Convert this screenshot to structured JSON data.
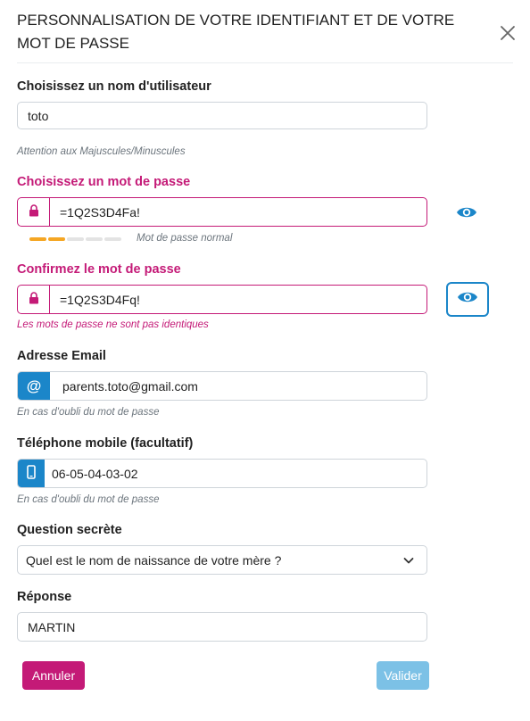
{
  "modal": {
    "title": "PERSONNALISATION DE VOTRE IDENTIFIANT ET DE VOTRE MOT DE PASSE"
  },
  "username": {
    "label": "Choisissez un nom d'utilisateur",
    "value": "toto",
    "hint": "Attention aux Majuscules/Minuscules"
  },
  "password": {
    "label": "Choisissez un mot de passe",
    "value": "=1Q2S3D4Fa!",
    "strength_segments": 5,
    "strength_filled": 2,
    "strength_label": "Mot de passe normal"
  },
  "confirm": {
    "label": "Confirmez le mot de passe",
    "value": "=1Q2S3D4Fq!",
    "error": "Les mots de passe ne sont pas identiques"
  },
  "email": {
    "label": "Adresse Email",
    "icon": "@",
    "value": "parents.toto@gmail.com",
    "hint": "En cas d'oubli du mot de passe"
  },
  "phone": {
    "label": "Téléphone mobile (facultatif)",
    "value": "06-05-04-03-02",
    "hint": "En cas d'oubli du mot de passe"
  },
  "secret_question": {
    "label": "Question secrète",
    "selected": "Quel est le nom de naissance de votre mère ?"
  },
  "answer": {
    "label": "Réponse",
    "value": "MARTIN"
  },
  "buttons": {
    "cancel": "Annuler",
    "submit": "Valider"
  },
  "colors": {
    "accent_pink": "#c41a77",
    "accent_blue": "#1b86c9",
    "strength_on": "#f5a623",
    "submit_disabled": "#7cc1e6"
  },
  "icons": [
    "close-icon",
    "lock-icon",
    "eye-icon",
    "at-icon",
    "mobile-phone-icon",
    "chevron-down-icon"
  ]
}
